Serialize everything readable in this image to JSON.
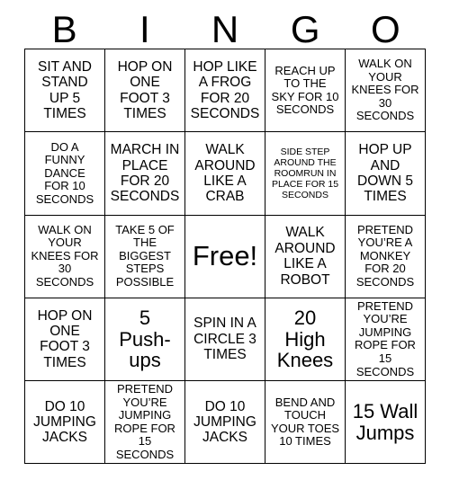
{
  "card": {
    "header_letters": [
      "B",
      "I",
      "N",
      "G",
      "O"
    ],
    "rows": [
      [
        {
          "text": "SIT AND\nSTAND\nUP 5\nTIMES",
          "size": "md"
        },
        {
          "text": "HOP ON\nONE\nFOOT 3\nTIMES",
          "size": "md"
        },
        {
          "text": "HOP LIKE\nA FROG\nFOR 20\nSECONDS",
          "size": "md"
        },
        {
          "text": "REACH UP\nTO THE\nSKY FOR 10\nSECONDS",
          "size": "sm"
        },
        {
          "text": "WALK ON\nYOUR\nKNEES FOR\n30\nSECONDS",
          "size": "sm"
        }
      ],
      [
        {
          "text": "DO A\nFUNNY\nDANCE\nFOR 10\nSECONDS",
          "size": "sm"
        },
        {
          "text": "MARCH IN\nPLACE\nFOR 20\nSECONDS",
          "size": "md"
        },
        {
          "text": "WALK\nAROUND\nLIKE A\nCRAB",
          "size": "md"
        },
        {
          "text": "SIDE STEP\nAROUND THE\nROOMRUN IN\nPLACE FOR 15\nSECONDS",
          "size": "xs"
        },
        {
          "text": "HOP UP\nAND\nDOWN 5\nTIMES",
          "size": "md"
        }
      ],
      [
        {
          "text": "WALK ON\nYOUR\nKNEES FOR\n30\nSECONDS",
          "size": "sm"
        },
        {
          "text": "TAKE 5 OF\nTHE\nBIGGEST\nSTEPS\nPOSSIBLE",
          "size": "sm"
        },
        {
          "text": "Free!",
          "size": "xl"
        },
        {
          "text": "WALK\nAROUND\nLIKE A\nROBOT",
          "size": "md"
        },
        {
          "text": "PRETEND\nYOU’RE A\nMONKEY\nFOR 20\nSECONDS",
          "size": "sm"
        }
      ],
      [
        {
          "text": "HOP ON\nONE\nFOOT 3\nTIMES",
          "size": "md"
        },
        {
          "text": "5\nPush-\nups",
          "size": "lg"
        },
        {
          "text": "SPIN IN A\nCIRCLE 3\nTIMES",
          "size": "md"
        },
        {
          "text": "20\nHigh\nKnees",
          "size": "lg"
        },
        {
          "text": "PRETEND\nYOU’RE\nJUMPING\nROPE FOR\n15 SECONDS",
          "size": "sm"
        }
      ],
      [
        {
          "text": "DO 10\nJUMPING\nJACKS",
          "size": "md"
        },
        {
          "text": "PRETEND\nYOU’RE\nJUMPING\nROPE FOR\n15 SECONDS",
          "size": "sm"
        },
        {
          "text": "DO 10\nJUMPING\nJACKS",
          "size": "md"
        },
        {
          "text": "BEND AND\nTOUCH\nYOUR TOES\n10 TIMES",
          "size": "sm"
        },
        {
          "text": "15 Wall\nJumps",
          "size": "lg"
        }
      ]
    ]
  },
  "colors": {
    "background": "#ffffff",
    "grid_line": "#000000",
    "text": "#000000"
  }
}
